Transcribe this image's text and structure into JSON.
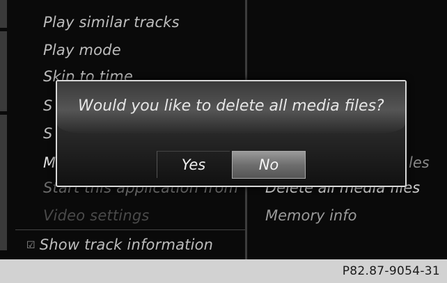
{
  "menu": {
    "items": [
      "Play similar tracks",
      "Play mode",
      "Skip to time",
      "S",
      "S",
      "M",
      "Start this application from",
      "Video settings"
    ],
    "show_track_info": "Show track information"
  },
  "right_menu": {
    "partial": "les",
    "delete_all": "Delete all media files",
    "memory_info": "Memory info"
  },
  "dialog": {
    "message": "Would you like to delete all media files?",
    "yes_label": "Yes",
    "no_label": "No",
    "selected": "No"
  },
  "caption": "P82.87-9054-31"
}
